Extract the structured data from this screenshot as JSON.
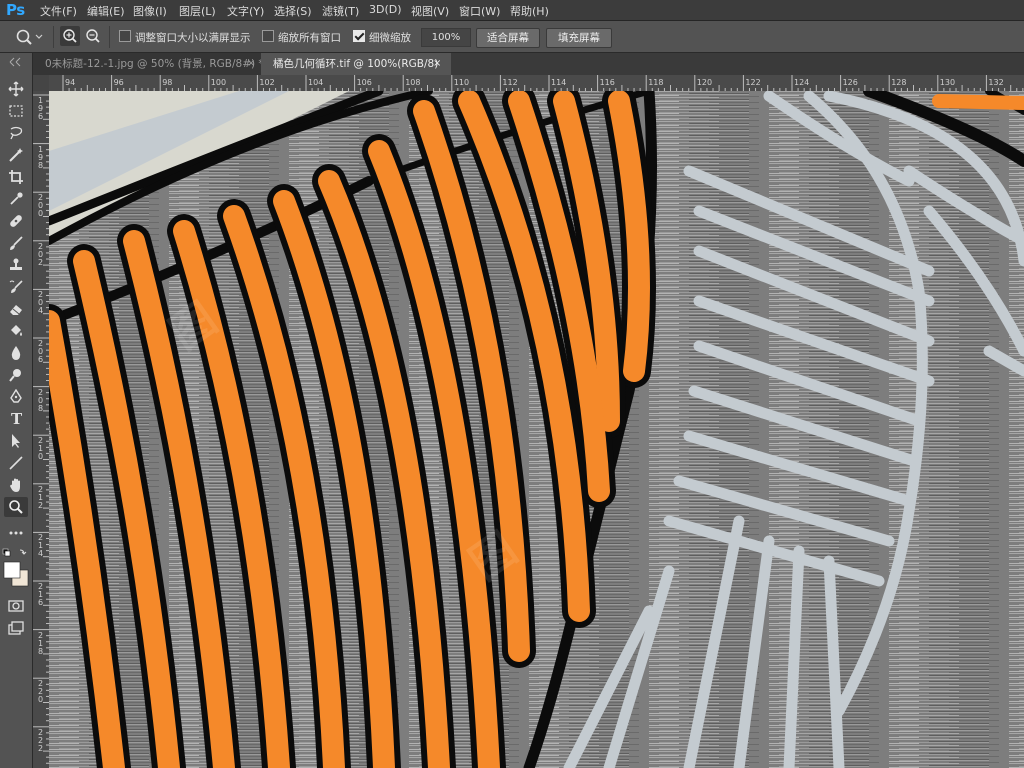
{
  "app": {
    "logo": "Ps"
  },
  "menu": [
    "文件(F)",
    "编辑(E)",
    "图像(I)",
    "图层(L)",
    "文字(Y)",
    "选择(S)",
    "滤镜(T)",
    "3D(D)",
    "视图(V)",
    "窗口(W)",
    "帮助(H)"
  ],
  "options": {
    "resize_windows_label": "调整窗口大小以满屏显示",
    "zoom_all_windows_label": "缩放所有窗口",
    "scrubby_zoom_label": "细微缩放",
    "zoom_percent": "100%",
    "fit_screen_label": "适合屏幕",
    "fill_screen_label": "填充屏幕",
    "resize_windows_checked": false,
    "zoom_all_windows_checked": false,
    "scrubby_zoom_checked": true
  },
  "tabs": [
    {
      "label": "0未标题-12.-1.jpg @ 50% (背景, RGB/8#) *",
      "close": "×",
      "active": false
    },
    {
      "label": "橘色几何循环.tif @ 100%(RGB/8)",
      "close": "×",
      "active": true
    }
  ],
  "ruler": {
    "horizontal": [
      "94",
      "96",
      "98",
      "100",
      "102",
      "104",
      "106",
      "108",
      "110",
      "112",
      "114",
      "116",
      "118",
      "120",
      "122",
      "124",
      "126",
      "128",
      "130",
      "132"
    ],
    "vertical": [
      "196",
      "198",
      "200",
      "202",
      "204",
      "206",
      "208",
      "210",
      "212",
      "214",
      "216",
      "218",
      "220",
      "222"
    ]
  },
  "tools": [
    "move-tool",
    "marquee-tool",
    "lasso-tool",
    "quick-selection-tool",
    "crop-tool",
    "eyedropper-tool",
    "healing-brush-tool",
    "brush-tool",
    "clone-stamp-tool",
    "history-brush-tool",
    "eraser-tool",
    "paint-bucket-tool",
    "blur-tool",
    "dodge-tool",
    "pen-tool",
    "type-tool",
    "path-selection-tool",
    "line-tool",
    "hand-tool",
    "zoom-tool",
    "more-tools"
  ],
  "colors": {
    "orange": "#f5892a",
    "black_stroke": "#0b0b0b",
    "light_stroke": "#c4cbd0",
    "cream": "#d8d8cf",
    "foreground_swatch": "#ffffff",
    "background_swatch": "#f1e6d6",
    "ps_blue": "#31a8ff"
  }
}
